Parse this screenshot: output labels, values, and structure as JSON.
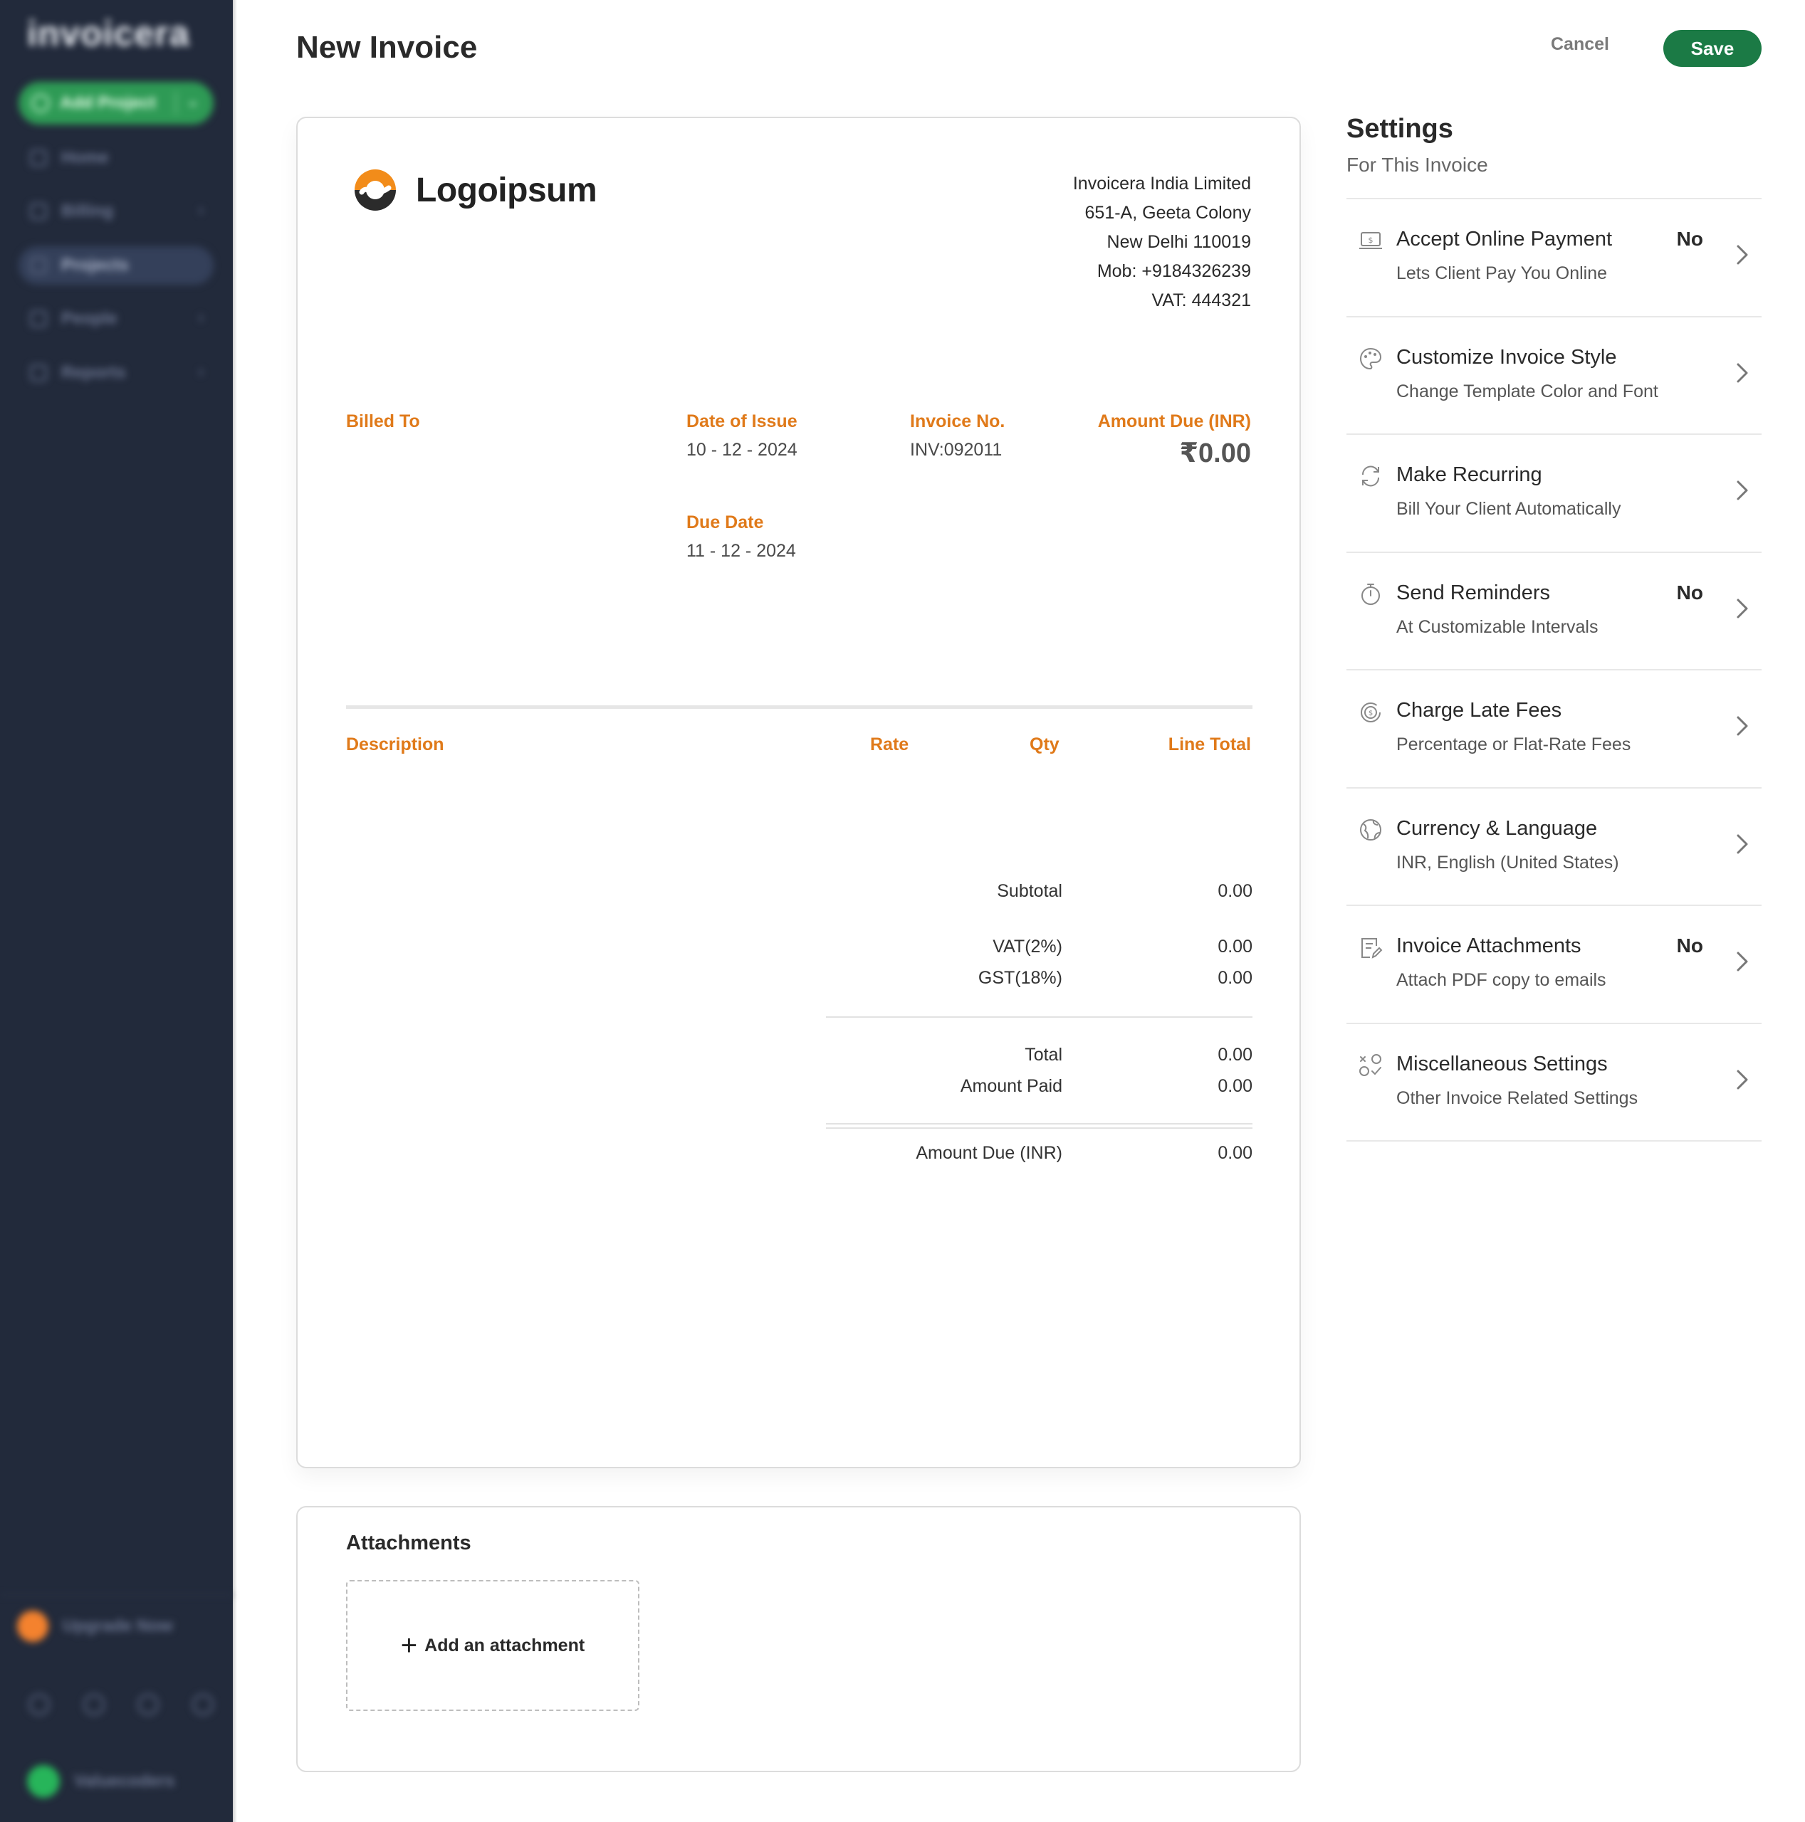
{
  "sidebar": {
    "brand": "invoicera",
    "add_project": "Add Project",
    "items": [
      {
        "label": "Home"
      },
      {
        "label": "Billing"
      },
      {
        "label": "Projects"
      },
      {
        "label": "People"
      },
      {
        "label": "Reports"
      }
    ],
    "upgrade": "Upgrade Now",
    "user": "Valuecoders"
  },
  "header": {
    "title": "New Invoice",
    "cancel": "Cancel",
    "save": "Save"
  },
  "invoice": {
    "logo_text": "Logoipsum",
    "company": {
      "name": "Invoicera India Limited",
      "address1": "651-A, Geeta Colony",
      "address2": "New Delhi 110019",
      "mobile": "Mob: +9184326239",
      "vat": "VAT: 444321"
    },
    "billed_to_label": "Billed To",
    "date_of_issue_label": "Date of Issue",
    "date_of_issue": "10 - 12 - 2024",
    "invoice_no_label": "Invoice No.",
    "invoice_no": "INV:092011",
    "amount_due_label": "Amount Due (INR)",
    "amount_due": "₹0.00",
    "due_date_label": "Due Date",
    "due_date": "11 - 12 - 2024",
    "columns": {
      "description": "Description",
      "rate": "Rate",
      "qty": "Qty",
      "line_total": "Line Total"
    },
    "totals": {
      "subtotal_label": "Subtotal",
      "subtotal": "0.00",
      "vat_label": "VAT(2%)",
      "vat": "0.00",
      "gst_label": "GST(18%)",
      "gst": "0.00",
      "total_label": "Total",
      "total": "0.00",
      "amount_paid_label": "Amount Paid",
      "amount_paid": "0.00",
      "amount_due_label": "Amount Due (INR)",
      "amount_due": "0.00"
    }
  },
  "attachments": {
    "title": "Attachments",
    "add_label": "Add an attachment"
  },
  "settings": {
    "title": "Settings",
    "subtitle": "For This Invoice",
    "items": [
      {
        "title": "Accept Online Payment",
        "desc": "Lets Client Pay You Online",
        "status": "No",
        "icon": "online-payment-icon"
      },
      {
        "title": "Customize Invoice Style",
        "desc": "Change Template Color and Font",
        "status": "",
        "icon": "palette-icon"
      },
      {
        "title": "Make Recurring",
        "desc": "Bill Your Client Automatically",
        "status": "",
        "icon": "recurring-icon"
      },
      {
        "title": "Send Reminders",
        "desc": "At Customizable Intervals",
        "status": "No",
        "icon": "stopwatch-icon"
      },
      {
        "title": "Charge Late Fees",
        "desc": "Percentage or Flat-Rate Fees",
        "status": "",
        "icon": "late-fee-icon"
      },
      {
        "title": "Currency & Language",
        "desc": "INR, English (United States)",
        "status": "",
        "icon": "globe-icon"
      },
      {
        "title": "Invoice Attachments",
        "desc": "Attach PDF copy to emails",
        "status": "No",
        "icon": "document-edit-icon"
      },
      {
        "title": "Miscellaneous Settings",
        "desc": "Other Invoice Related Settings",
        "status": "",
        "icon": "misc-settings-icon"
      }
    ]
  },
  "colors": {
    "sidebar_bg": "#222a3b",
    "accent_orange": "#e07a1a",
    "save_green": "#1b7a45"
  }
}
